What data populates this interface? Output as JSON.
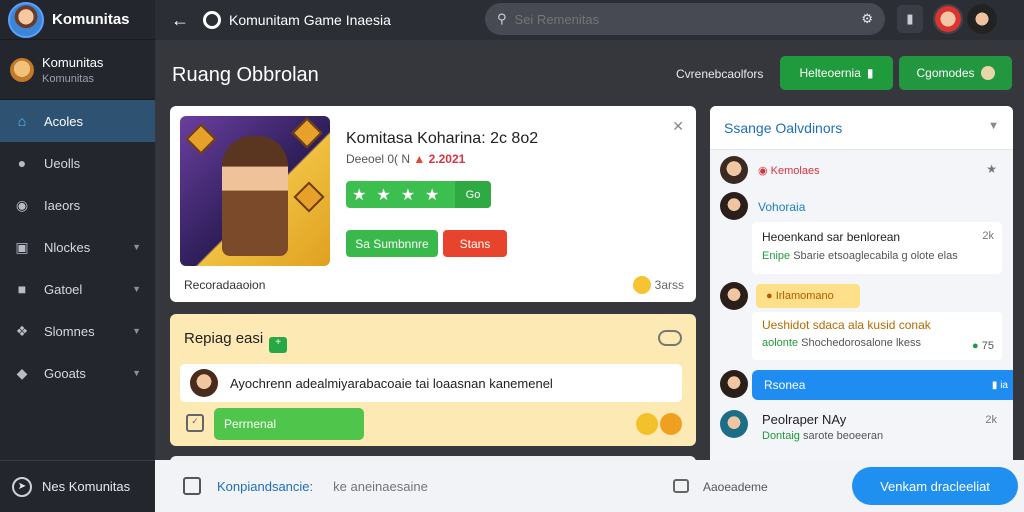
{
  "app": {
    "name": "Komunitas"
  },
  "profile": {
    "name": "Komunitas",
    "subtitle": "Komunitas"
  },
  "sidebar": {
    "items": [
      {
        "label": "Acoles",
        "icon": "home-icon"
      },
      {
        "label": "Ueolls",
        "icon": "avatar-icon"
      },
      {
        "label": "Iaeors",
        "icon": "bubble-icon"
      },
      {
        "label": "Nlockes",
        "icon": "box-icon"
      },
      {
        "label": "Gatoel",
        "icon": "lock-icon"
      },
      {
        "label": "Slomnes",
        "icon": "puzzle-icon"
      },
      {
        "label": "Gooats",
        "icon": "location-icon"
      }
    ],
    "footer": "Nes Komunitas"
  },
  "topbar": {
    "title": "Komunitam Game Inaesia",
    "search_placeholder": "Sei Remenitas"
  },
  "header": {
    "title": "Ruang Obbrolan",
    "link": "Cvrenebcaolfors",
    "btn1": "Helteoernia",
    "btn1_suffix": "▮",
    "btn2": "Cgomodes"
  },
  "game_card": {
    "title": "Komitasa Koharina: 2c 8o2",
    "subtitle_prefix": "Deeoel 0( N",
    "subtitle_highlight": "2.2021",
    "rating_count": "Go",
    "btn_green": "Sa Sumbnnre",
    "btn_red": "Stans",
    "footer": "Recoradaaoion",
    "count": "3arss"
  },
  "reply_card": {
    "title": "Repiag easi",
    "badge": "+",
    "message": "Ayochrenn adealmiyarabacoaie tai loaasnan kanemenel",
    "input": "Perrnenal"
  },
  "panel": {
    "title": "Ssange Oalvdinors",
    "items": [
      {
        "label": "Kemolaes"
      },
      {
        "label": "Vohoraia"
      },
      {
        "text": "Heoenkand sar benlorean",
        "sub_green": "Enipe",
        "sub": "Sbarie etsoaglecabila g olote elas",
        "count": "2k"
      },
      {
        "tag": "Irlamomano"
      },
      {
        "text": "Ueshidot sdaca ala kusid conak",
        "sub_green": "aolonte",
        "sub": "Shochedorosalone lkess",
        "count": "75"
      },
      {
        "label": "Rsonea",
        "meta": "▮ ia"
      },
      {
        "title": "Peolraper NAy",
        "sub_green": "Dontaig",
        "sub": "sarote beoeeran",
        "count": "2k"
      }
    ]
  },
  "bottombar": {
    "link": "Konpiandsancie:",
    "placeholder": "ke aneinaesaine",
    "label": "Aaoeademe",
    "button": "Venkam dracleeliat"
  }
}
